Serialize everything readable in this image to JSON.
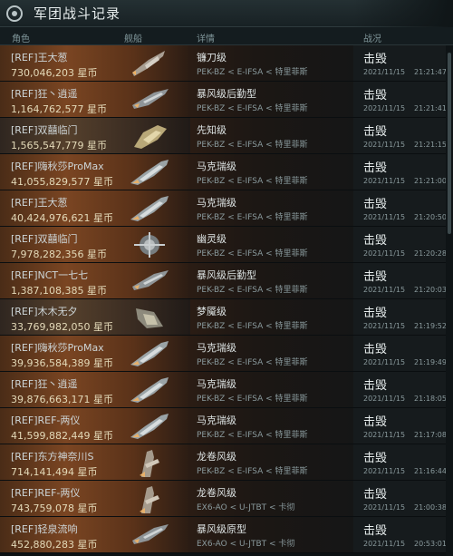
{
  "window": {
    "title": "军团战斗记录"
  },
  "columns": {
    "role": "角色",
    "ship": "舰船",
    "detail": "详情",
    "result": "战况"
  },
  "rows": [
    {
      "pilot": "[REF]王大葱",
      "value": "730,046,203 星币",
      "ship": "镰刀级",
      "location": "PEK-BZ < E-IFSA < 特里菲斯",
      "result": "击毁",
      "date": "2021/11/15",
      "time": "21:21:47",
      "icon": "destroyer-ship-icon",
      "dark": false
    },
    {
      "pilot": "[REF]狂丶逍遥",
      "value": "1,164,762,577 星币",
      "ship": "暴风级后勤型",
      "location": "PEK-BZ < E-IFSA < 特里菲斯",
      "result": "击毁",
      "date": "2021/11/15",
      "time": "21:21:41",
      "icon": "cruiser-ship-icon",
      "dark": false
    },
    {
      "pilot": "[REF]双囍临门",
      "value": "1,565,547,779 星币",
      "ship": "先知级",
      "location": "PEK-BZ < E-IFSA < 特里菲斯",
      "result": "击毁",
      "date": "2021/11/15",
      "time": "21:21:15",
      "icon": "battlecruiser-ship-icon",
      "dark": true
    },
    {
      "pilot": "[REF]嗨秋莎ProMax",
      "value": "41,055,829,577 星币",
      "ship": "马克瑞级",
      "location": "PEK-BZ < E-IFSA < 特里菲斯",
      "result": "击毁",
      "date": "2021/11/15",
      "time": "21:21:00",
      "icon": "battleship-icon",
      "dark": false
    },
    {
      "pilot": "[REF]王大葱",
      "value": "40,424,976,621 星币",
      "ship": "马克瑞级",
      "location": "PEK-BZ < E-IFSA < 特里菲斯",
      "result": "击毁",
      "date": "2021/11/15",
      "time": "21:20:50",
      "icon": "battleship-icon",
      "dark": false
    },
    {
      "pilot": "[REF]双囍临门",
      "value": "7,978,282,356 星币",
      "ship": "幽灵级",
      "location": "PEK-BZ < E-IFSA < 特里菲斯",
      "result": "击毁",
      "date": "2021/11/15",
      "time": "21:20:28",
      "icon": "ghost-ship-icon",
      "dark": false
    },
    {
      "pilot": "[REF]NCT一七七",
      "value": "1,387,108,385 星币",
      "ship": "暴风级后勤型",
      "location": "PEK-BZ < E-IFSA < 特里菲斯",
      "result": "击毁",
      "date": "2021/11/15",
      "time": "21:20:03",
      "icon": "cruiser-ship-icon",
      "dark": false
    },
    {
      "pilot": "[REF]木木无夕",
      "value": "33,769,982,050 星币",
      "ship": "梦魇级",
      "location": "PEK-BZ < E-IFSA < 特里菲斯",
      "result": "击毁",
      "date": "2021/11/15",
      "time": "21:19:52",
      "icon": "nightmare-ship-icon",
      "dark": true
    },
    {
      "pilot": "[REF]嗨秋莎ProMax",
      "value": "39,936,584,389 星币",
      "ship": "马克瑞级",
      "location": "PEK-BZ < E-IFSA < 特里菲斯",
      "result": "击毁",
      "date": "2021/11/15",
      "time": "21:19:49",
      "icon": "battleship-icon",
      "dark": false
    },
    {
      "pilot": "[REF]狂丶逍遥",
      "value": "39,876,663,171 星币",
      "ship": "马克瑞级",
      "location": "PEK-BZ < E-IFSA < 特里菲斯",
      "result": "击毁",
      "date": "2021/11/15",
      "time": "21:18:05",
      "icon": "battleship-icon",
      "dark": false
    },
    {
      "pilot": "[REF]REF-两仪",
      "value": "41,599,882,449 星币",
      "ship": "马克瑞级",
      "location": "PEK-BZ < E-IFSA < 特里菲斯",
      "result": "击毁",
      "date": "2021/11/15",
      "time": "21:17:08",
      "icon": "battleship-icon",
      "dark": false
    },
    {
      "pilot": "[REF]东方神奈川S",
      "value": "714,141,494 星币",
      "ship": "龙卷风级",
      "location": "PEK-BZ < E-IFSA < 特里菲斯",
      "result": "击毁",
      "date": "2021/11/15",
      "time": "21:16:44",
      "icon": "tornado-ship-icon",
      "dark": false
    },
    {
      "pilot": "[REF]REF-两仪",
      "value": "743,759,078 星币",
      "ship": "龙卷风级",
      "location": "EX6-AO < U-JTBT < 卡彻",
      "result": "击毁",
      "date": "2021/11/15",
      "time": "21:00:38",
      "icon": "tornado-ship-icon",
      "dark": false
    },
    {
      "pilot": "[REF]轻泉流响",
      "value": "452,880,283 星币",
      "ship": "暴风级原型",
      "location": "EX6-AO < U-JTBT < 卡彻",
      "result": "击毁",
      "date": "2021/11/15",
      "time": "20:53:01",
      "icon": "cruiser-ship-icon",
      "dark": false
    }
  ]
}
